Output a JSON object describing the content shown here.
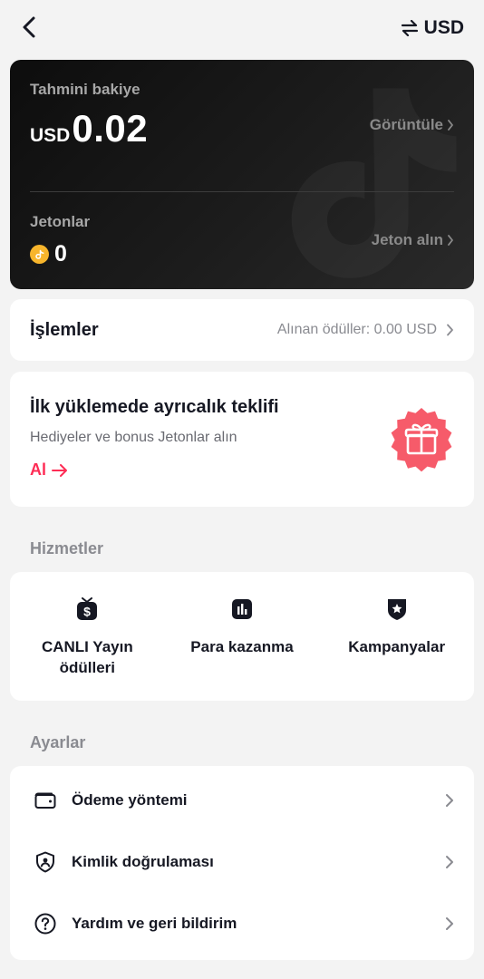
{
  "topbar": {
    "back_icon": "chevron-left-icon",
    "currency_icon": "swap-arrows-icon",
    "currency_label": "USD"
  },
  "balance": {
    "estimated_label": "Tahmini bakiye",
    "currency": "USD",
    "amount": "0.02",
    "view_label": "Görüntüle",
    "coins_label": "Jetonlar",
    "coins_value": "0",
    "get_coins_label": "Jeton alın",
    "card_colors": [
      "#0d0d0d",
      "#2a2a2a"
    ]
  },
  "transactions": {
    "title": "İşlemler",
    "summary": "Alınan ödüller: 0.00 USD"
  },
  "offer": {
    "title": "İlk yüklemede ayrıcalık teklifi",
    "subtitle": "Hediyeler ve bonus Jetonlar alın",
    "cta_label": "Al",
    "badge_icon": "gift-icon",
    "accent": "#fe2c55"
  },
  "services": {
    "section_title": "Hizmetler",
    "items": [
      {
        "label": "CANLI Yayın ödülleri",
        "icon": "live-rewards-icon"
      },
      {
        "label": "Para kazanma",
        "icon": "chart-icon"
      },
      {
        "label": "Kampanyalar",
        "icon": "campaign-badge-icon"
      }
    ]
  },
  "settings": {
    "section_title": "Ayarlar",
    "items": [
      {
        "label": "Ödeme yöntemi",
        "icon": "wallet-icon"
      },
      {
        "label": "Kimlik doğrulaması",
        "icon": "shield-user-icon"
      },
      {
        "label": "Yardım ve geri bildirim",
        "icon": "help-circle-icon"
      }
    ]
  }
}
